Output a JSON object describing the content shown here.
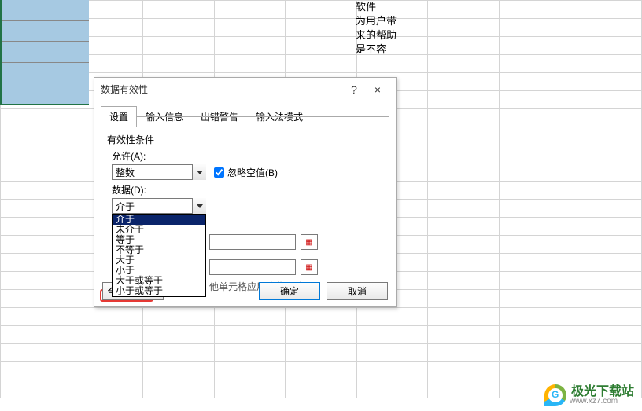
{
  "background_text": "软件\n为用户带\n来的帮助\n是不容",
  "dialog": {
    "title": "数据有效性",
    "help_symbol": "?",
    "close_symbol": "×",
    "tabs": [
      "设置",
      "输入信息",
      "出错警告",
      "输入法模式"
    ],
    "section_label": "有效性条件",
    "allow_label": "允许(A):",
    "allow_value": "整数",
    "ignore_blank_label": "忽略空值(B)",
    "data_label": "数据(D):",
    "data_value": "介于",
    "data_options": [
      "介于",
      "未介于",
      "等于",
      "不等于",
      "大于",
      "小于",
      "大于或等于",
      "小于或等于"
    ],
    "apply_to_others": "他单元格应用这些更改(P)",
    "clear_all": "全部清除(C)",
    "ok": "确定",
    "cancel": "取消"
  },
  "watermark": {
    "brand": "极光下载站",
    "url": "www.xz7.com"
  }
}
